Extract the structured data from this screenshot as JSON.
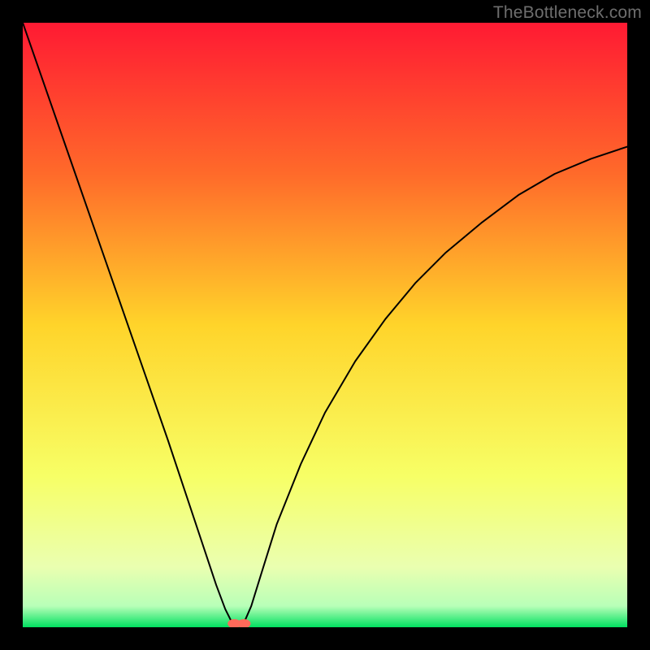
{
  "watermark": "TheBottleneck.com",
  "chart_data": {
    "type": "line",
    "title": "",
    "xlabel": "",
    "ylabel": "",
    "xlim": [
      0,
      100
    ],
    "ylim": [
      0,
      100
    ],
    "background_gradient": {
      "stops": [
        {
          "pos": 0.0,
          "color": "#ff1a33"
        },
        {
          "pos": 0.25,
          "color": "#ff6a2a"
        },
        {
          "pos": 0.5,
          "color": "#ffd42a"
        },
        {
          "pos": 0.75,
          "color": "#f7ff66"
        },
        {
          "pos": 0.9,
          "color": "#eaffb0"
        },
        {
          "pos": 0.965,
          "color": "#b8ffb8"
        },
        {
          "pos": 1.0,
          "color": "#00e060"
        }
      ]
    },
    "series": [
      {
        "name": "bottleneck-curve",
        "stroke": "#000000",
        "stroke_width": 2,
        "x": [
          0,
          4,
          8,
          12,
          16,
          20,
          24,
          27,
          30,
          32,
          33.5,
          34.5,
          35.2,
          36.0,
          36.8,
          37.8,
          39.5,
          42,
          46,
          50,
          55,
          60,
          65,
          70,
          76,
          82,
          88,
          94,
          100
        ],
        "y": [
          100,
          88.5,
          77,
          65.5,
          54,
          42.5,
          31,
          22,
          13,
          7,
          3,
          1,
          0.3,
          0.3,
          1.2,
          3.5,
          9,
          17,
          27,
          35.5,
          44,
          51,
          57,
          62,
          67,
          71.5,
          75,
          77.5,
          79.5
        ]
      }
    ],
    "markers": [
      {
        "name": "min-point-left",
        "shape": "ellipse",
        "cx": 35.0,
        "cy": 0.6,
        "rx": 1.1,
        "ry": 0.75,
        "fill": "#ff6a5a"
      },
      {
        "name": "min-point-right",
        "shape": "ellipse",
        "cx": 36.6,
        "cy": 0.6,
        "rx": 1.1,
        "ry": 0.75,
        "fill": "#ff6a5a"
      }
    ]
  }
}
